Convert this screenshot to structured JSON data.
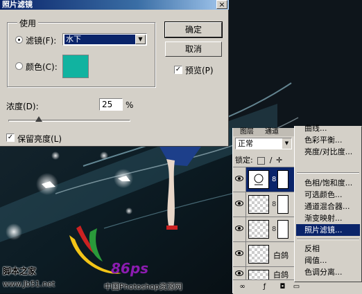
{
  "dialog": {
    "title": "照片滤镜",
    "close_glyph": "×",
    "use_group_label": "使用",
    "filter_label": "滤镜(F):",
    "filter_value": "水下",
    "color_label": "颜色(C):",
    "color_value": "#11b3a0",
    "ok_label": "确定",
    "cancel_label": "取消",
    "preview_label": "预览(P)",
    "preview_checked": true,
    "density_label": "浓度(D):",
    "density_value": "25",
    "density_unit": "%",
    "density_level": 25,
    "preserve_label": "保留亮度(L)",
    "preserve_checked": true
  },
  "layers_panel": {
    "tabs": [
      "图层",
      "通道"
    ],
    "blend_mode": "正常",
    "lock_label": "锁定:",
    "layers": [
      {
        "name": "",
        "selected": true
      },
      {
        "name": "",
        "selected": false
      },
      {
        "name": "",
        "selected": false
      },
      {
        "name": "白鸽",
        "selected": false
      },
      {
        "name": "白鸽",
        "selected": false
      }
    ]
  },
  "menu": {
    "items": [
      {
        "label": "曲线...",
        "highlighted": false
      },
      {
        "label": "色彩平衡...",
        "highlighted": false
      },
      {
        "label": "亮度/对比度...",
        "highlighted": false
      },
      {
        "label": "色相/饱和度...",
        "highlighted": false
      },
      {
        "label": "可选颜色...",
        "highlighted": false
      },
      {
        "label": "通道混合器...",
        "highlighted": false
      },
      {
        "label": "渐变映射...",
        "highlighted": false
      },
      {
        "label": "照片滤镜...",
        "highlighted": true
      },
      {
        "label": "反相",
        "highlighted": false
      },
      {
        "label": "阈值...",
        "highlighted": false
      },
      {
        "label": "色调分离...",
        "highlighted": false
      }
    ]
  },
  "watermark": {
    "site_name": "脚本之家",
    "site_url": "www.Jb51.net",
    "logo_text": "86ps",
    "brand_text": "中国Photoshop资源网"
  },
  "colors": {
    "title_bar": "#0a246a",
    "selection": "#0a246a",
    "dialog_bg": "#d4d0c8",
    "swatch": "#11b3a0"
  }
}
